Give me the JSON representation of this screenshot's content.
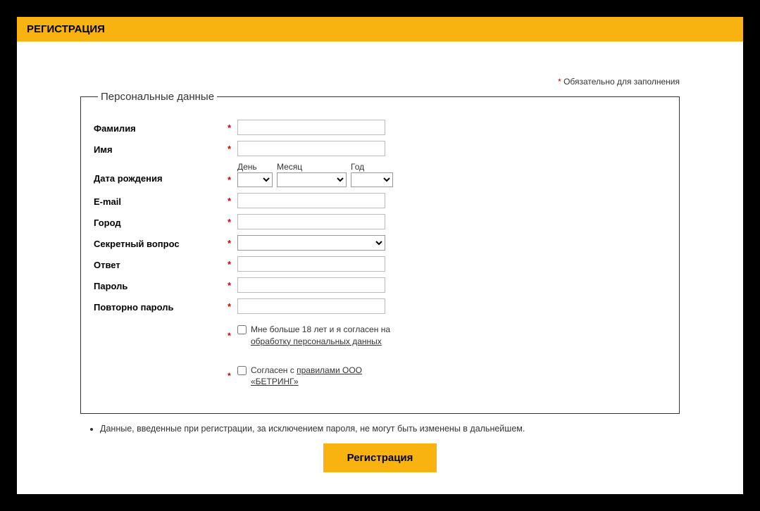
{
  "header": {
    "title": "РЕГИСТРАЦИЯ"
  },
  "required_note": {
    "star": "*",
    "text": " Обязательно для заполнения"
  },
  "fieldset": {
    "legend": "Персональные данные",
    "surname": {
      "label": "Фамилия"
    },
    "name": {
      "label": "Имя"
    },
    "dob": {
      "label": "Дата рождения",
      "day": "День",
      "month": "Месяц",
      "year": "Год"
    },
    "email": {
      "label": "E-mail"
    },
    "city": {
      "label": "Город"
    },
    "secret": {
      "label": "Секретный вопрос"
    },
    "answer": {
      "label": "Ответ"
    },
    "password": {
      "label": "Пароль"
    },
    "password2": {
      "label": "Повторно пароль"
    },
    "agree_age": {
      "text": "Мне больше 18 лет и я согласен на ",
      "link": "обработку персональных данных"
    },
    "agree_rules": {
      "text": "Согласен с ",
      "link": "правилами ООО «БЕТРИНГ»"
    }
  },
  "note_item": "Данные, введенные при регистрации, за исключением пароля, не могут быть изменены в дальнейшем.",
  "submit": "Регистрация",
  "star": "*"
}
